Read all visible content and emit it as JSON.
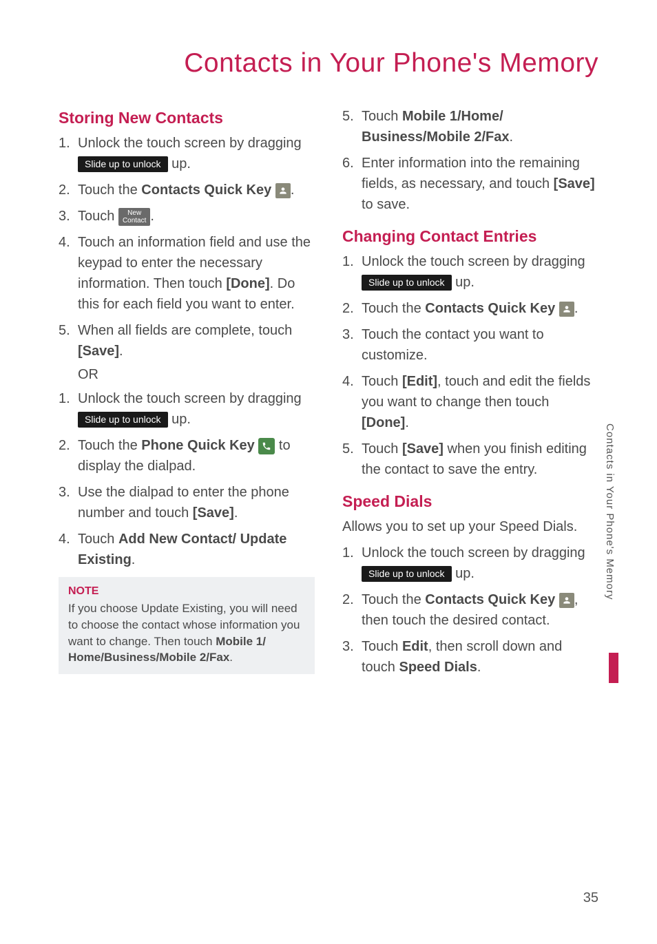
{
  "page": {
    "title": "Contacts in Your Phone's Memory",
    "side_tab": "Contacts in Your Phone's Memory",
    "number": "35"
  },
  "buttons": {
    "slide_unlock": "Slide up to unlock",
    "new_contact_l1": "New",
    "new_contact_l2": "Contact"
  },
  "left": {
    "h1": "Storing New Contacts",
    "s1_a": "Unlock the touch screen by dragging ",
    "s1_b": " up.",
    "s2_a": "Touch the ",
    "s2_b": "Contacts Quick Key ",
    "s2_c": ".",
    "s3_a": "Touch ",
    "s3_b": ".",
    "s4_a": "Touch an information field and use the keypad to enter the necessary information. Then touch ",
    "s4_b": "[Done]",
    "s4_c": ". Do this for each field you want to enter.",
    "s5_a": "When all fields are complete, touch ",
    "s5_b": "[Save]",
    "s5_c": ".",
    "or": "OR",
    "p1_a": "Unlock the touch screen by dragging ",
    "p1_b": " up.",
    "p2_a": "Touch the ",
    "p2_b": "Phone Quick Key",
    "p2_c": " to display the dialpad.",
    "p3_a": "Use the dialpad to enter the phone number and touch ",
    "p3_b": "[Save]",
    "p3_c": ".",
    "p4_a": "Touch ",
    "p4_b": "Add New Contact/ Update Existing",
    "p4_c": ".",
    "note_title": "NOTE",
    "note_a": "If you choose Update Existing, you will need to choose the contact whose information you want to change. Then touch ",
    "note_b": "Mobile 1/ Home/Business/Mobile 2/Fax",
    "note_c": "."
  },
  "right": {
    "r5_a": "Touch ",
    "r5_b": "Mobile 1/Home/ Business/Mobile 2/Fax",
    "r5_c": ".",
    "r6_a": "Enter information into the remaining fields, as necessary, and touch ",
    "r6_b": "[Save]",
    "r6_c": " to save.",
    "h2": "Changing Contact Entries",
    "c1_a": "Unlock the touch screen by dragging ",
    "c1_b": " up.",
    "c2_a": "Touch the ",
    "c2_b": "Contacts Quick Key ",
    "c2_c": ".",
    "c3": "Touch the contact you want to customize.",
    "c4_a": "Touch ",
    "c4_b": "[Edit]",
    "c4_c": ", touch and edit the fields you want to change then touch ",
    "c4_d": "[Done]",
    "c4_e": ".",
    "c5_a": "Touch ",
    "c5_b": "[Save]",
    "c5_c": " when you finish editing the contact to save the entry.",
    "h3": "Speed Dials",
    "sd_intro": "Allows you to set up your Speed Dials.",
    "d1_a": "Unlock the touch screen by dragging ",
    "d1_b": " up.",
    "d2_a": "Touch the ",
    "d2_b": "Contacts Quick Key ",
    "d2_c": ", then touch the desired contact.",
    "d3_a": "Touch ",
    "d3_b": "Edit",
    "d3_c": ", then scroll down and touch ",
    "d3_d": "Speed Dials",
    "d3_e": "."
  }
}
